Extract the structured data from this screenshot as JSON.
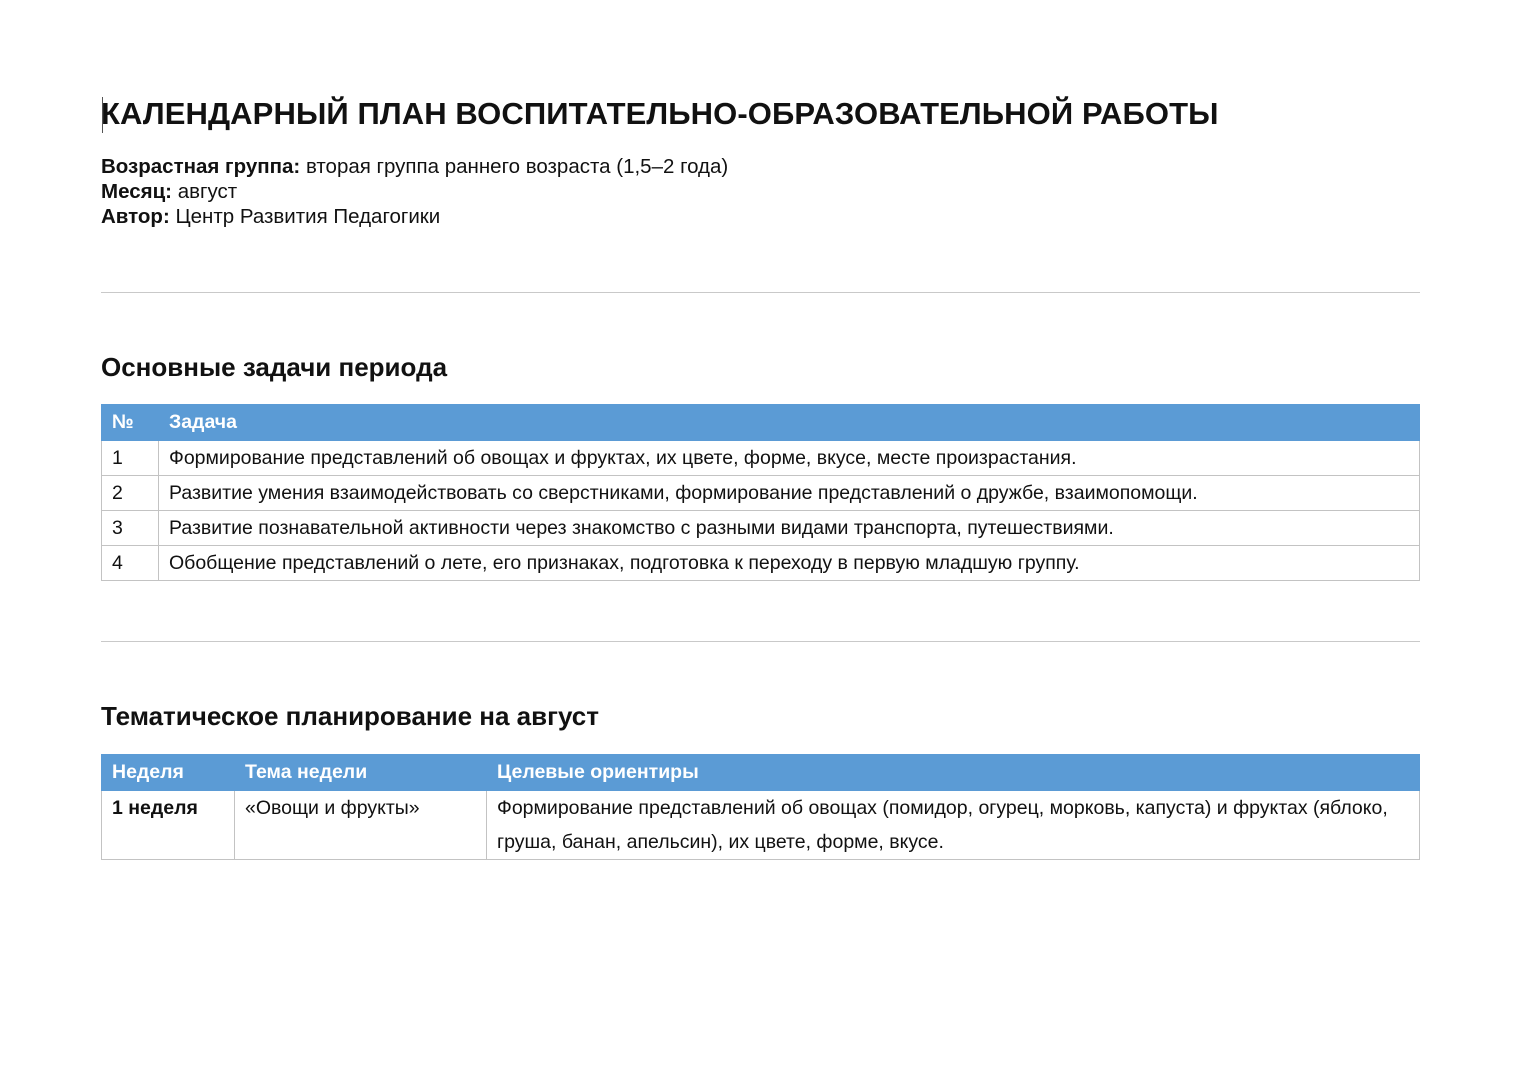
{
  "document": {
    "title": "КАЛЕНДАРНЫЙ ПЛАН ВОСПИТАТЕЛЬНО-ОБРАЗОВАТЕЛЬНОЙ РАБОТЫ",
    "meta": [
      {
        "label": "Возрастная группа:",
        "value": "вторая группа раннего возраста (1,5–2 года)"
      },
      {
        "label": "Месяц:",
        "value": "август"
      },
      {
        "label": "Автор:",
        "value": "Центр Развития Педагогики"
      }
    ]
  },
  "tasks": {
    "title": "Основные задачи периода",
    "headers": [
      "№",
      "Задача"
    ],
    "rows": [
      {
        "num": "1",
        "text": "Формирование представлений об овощах и фруктах, их цвете, форме, вкусе, месте произрастания."
      },
      {
        "num": "2",
        "text": "Развитие умения взаимодействовать со сверстниками, формирование представлений о дружбе, взаимопомощи."
      },
      {
        "num": "3",
        "text": "Развитие познавательной активности через знакомство с разными видами транспорта, путешествиями."
      },
      {
        "num": "4",
        "text": "Обобщение представлений о лете, его признаках, подготовка к переходу в первую младшую группу."
      }
    ]
  },
  "themes": {
    "title": "Тематическое планирование на август",
    "headers": [
      "Неделя",
      "Тема недели",
      "Целевые ориентиры"
    ],
    "rows": [
      {
        "week": "1 неделя",
        "theme": "«Овощи и фрукты»",
        "goals": "Формирование представлений об овощах (помидор, огурец, морковь, капуста) и фруктах (яблоко, груша, банан, апельсин), их цвете, форме, вкусе."
      }
    ]
  },
  "colors": {
    "header_bg": "#5b9bd5",
    "border": "#c3c3c3",
    "rule": "#c9c9c9"
  }
}
